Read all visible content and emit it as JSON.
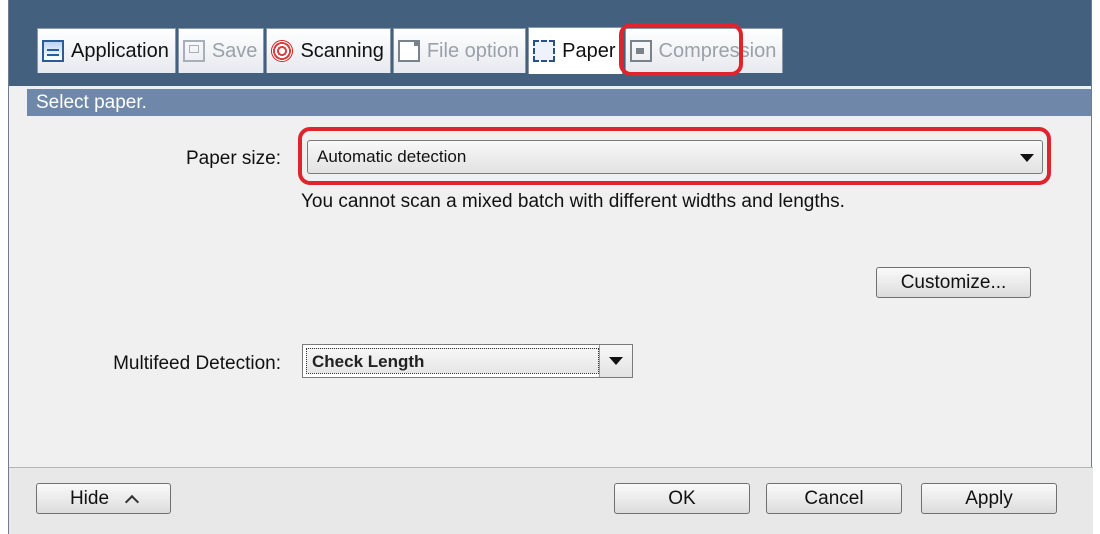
{
  "tabs": [
    {
      "label": "Application",
      "icon": "application-icon",
      "state": "enabled"
    },
    {
      "label": "Save",
      "icon": "save-icon",
      "state": "disabled"
    },
    {
      "label": "Scanning",
      "icon": "scanning-icon",
      "state": "enabled"
    },
    {
      "label": "File option",
      "icon": "file-option-icon",
      "state": "disabled"
    },
    {
      "label": "Paper",
      "icon": "paper-icon",
      "state": "active"
    },
    {
      "label": "Compression",
      "icon": "compression-icon",
      "state": "disabled"
    }
  ],
  "section": {
    "header": "Select paper."
  },
  "paper_size": {
    "label": "Paper size:",
    "value": "Automatic detection",
    "note": "You cannot scan a mixed batch with different widths and lengths."
  },
  "customize_button": "Customize...",
  "multifeed": {
    "label": "Multifeed Detection:",
    "value": "Check Length"
  },
  "footer": {
    "hide_label": "Hide",
    "ok_label": "OK",
    "cancel_label": "Cancel",
    "apply_label": "Apply"
  },
  "colors": {
    "title_bar": "#44607f",
    "section_header": "#6f87a8",
    "highlight": "#e0242e"
  }
}
